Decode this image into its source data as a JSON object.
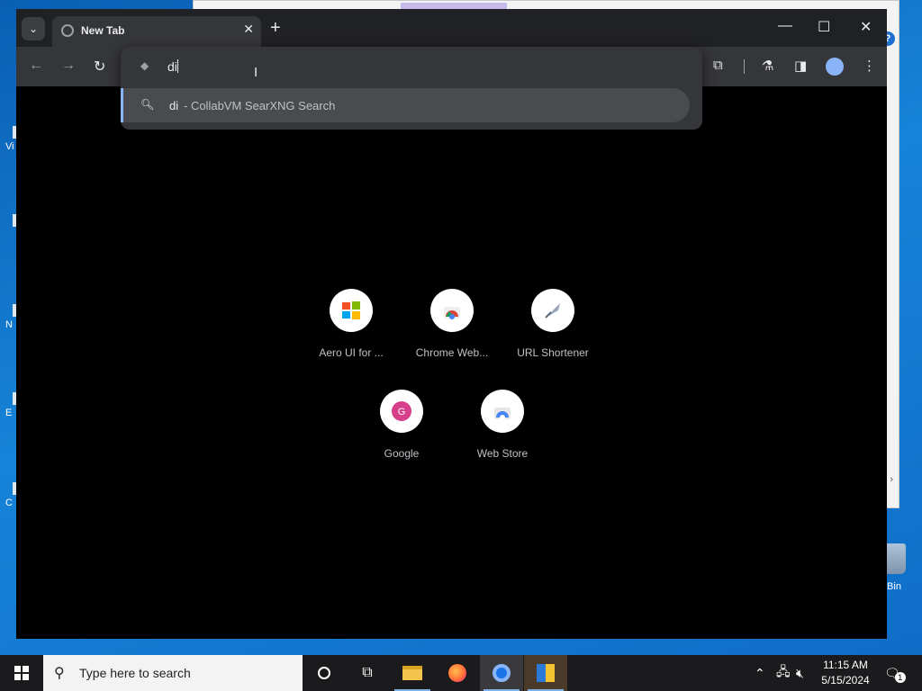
{
  "window": {
    "tab_title": "New Tab",
    "tab_close_glyph": "✕",
    "new_tab_glyph": "+",
    "minimize_glyph": "—",
    "maximize_glyph": "☐",
    "close_glyph": "✕"
  },
  "toolbar": {
    "back_glyph": "←",
    "forward_glyph": "→",
    "reload_glyph": "↻",
    "extensions_glyph": "⧉",
    "labs_glyph": "⚗",
    "side_panel_glyph": "◨",
    "menu_glyph": "⋮"
  },
  "omnibox": {
    "input_value": "di",
    "suggestion": {
      "query": "di",
      "description": "- CollabVM SearXNG Search"
    }
  },
  "shortcuts": [
    {
      "label": "Aero UI for ...",
      "icon": "windows-logo-icon"
    },
    {
      "label": "Chrome Web...",
      "icon": "chrome-web-store-icon"
    },
    {
      "label": "URL Shortener",
      "icon": "url-shortener-icon"
    },
    {
      "label": "Google",
      "icon": "google-letter-icon",
      "letter": "G",
      "color": "#d63f8a"
    },
    {
      "label": "Web Store",
      "icon": "web-store-icon"
    }
  ],
  "desktop": {
    "left_icon_labels": [
      "Vi",
      "",
      "N",
      "E",
      "C"
    ],
    "recycle_bin_label": "Bin"
  },
  "taskbar": {
    "search_placeholder": "Type here to search",
    "time": "11:15 AM",
    "date": "5/15/2024",
    "notification_count": "1"
  },
  "colors": {
    "accent": "#8ab4f8",
    "toolbar_bg": "#35363a",
    "titlebar_bg": "#202124",
    "page_bg": "#000000",
    "taskbar_bg": "#1b1b1d"
  }
}
